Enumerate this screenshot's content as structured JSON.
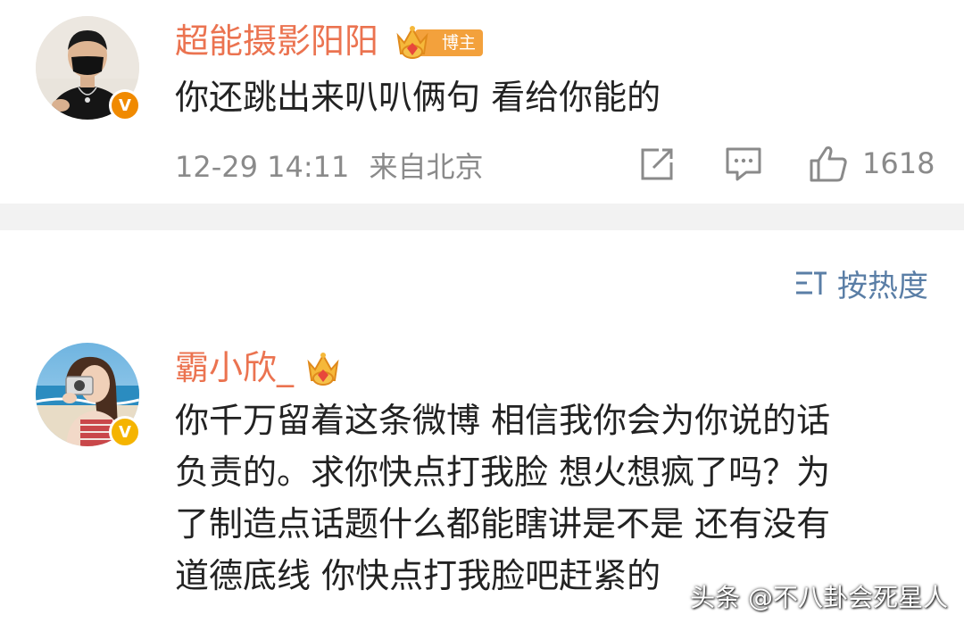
{
  "comment1": {
    "username": "超能摄影阳阳",
    "badge_label": "博主",
    "text": "你还跳出来叭叭俩句 看给你能的",
    "time": "12-29 14:11",
    "location": "来自北京",
    "like_count": "1618",
    "verify_mark": "V",
    "verify_color": "#f08a00"
  },
  "sort": {
    "label": "按热度"
  },
  "comment2": {
    "username": "霸小欣_",
    "text_lines": [
      "你千万留着这条微博 相信我你会为你说的话",
      "负责的。求你快点打我脸 想火想疯了吗？为",
      "了制造点话题什么都能瞎讲是不是 还有没有",
      "道德底线 你快点打我脸吧赶紧的"
    ],
    "verify_mark": "V",
    "verify_color": "#f5b400"
  },
  "watermark": "头条 @不八卦会死星人",
  "colors": {
    "username": "#eb7350",
    "meta": "#8a8a8a",
    "divider": "#f2f2f2",
    "icon": "#8a8a8a",
    "badge_bg": "#f3a13c",
    "sort_accent": "#5a7ea6"
  },
  "icons": [
    "crown-icon",
    "share-icon",
    "comment-icon",
    "like-icon",
    "sort-icon"
  ]
}
